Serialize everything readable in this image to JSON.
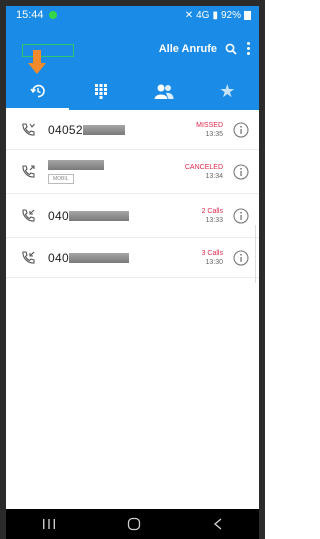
{
  "status_bar": {
    "time": "15:44",
    "network": "4G",
    "battery": "92%"
  },
  "header": {
    "title": "Alle Anrufe"
  },
  "tabs": [
    {
      "name": "recents"
    },
    {
      "name": "dialpad"
    },
    {
      "name": "contacts"
    },
    {
      "name": "favorites"
    }
  ],
  "calls": [
    {
      "number": "04052",
      "status": "MISSED",
      "time": "13:35",
      "tag": "",
      "redact_width": 42
    },
    {
      "number": "",
      "status": "CANCELED",
      "time": "13:34",
      "tag": "MOBIL",
      "redact_width": 56
    },
    {
      "number": "040",
      "status": "2 Calls",
      "time": "13:33",
      "tag": "",
      "redact_width": 60
    },
    {
      "number": "040",
      "status": "3 Calls",
      "time": "13:30",
      "tag": "",
      "redact_width": 60
    }
  ],
  "colors": {
    "accent": "#1a8be6",
    "status_red": "#e0284c",
    "annotation_orange": "#f08a2c"
  }
}
